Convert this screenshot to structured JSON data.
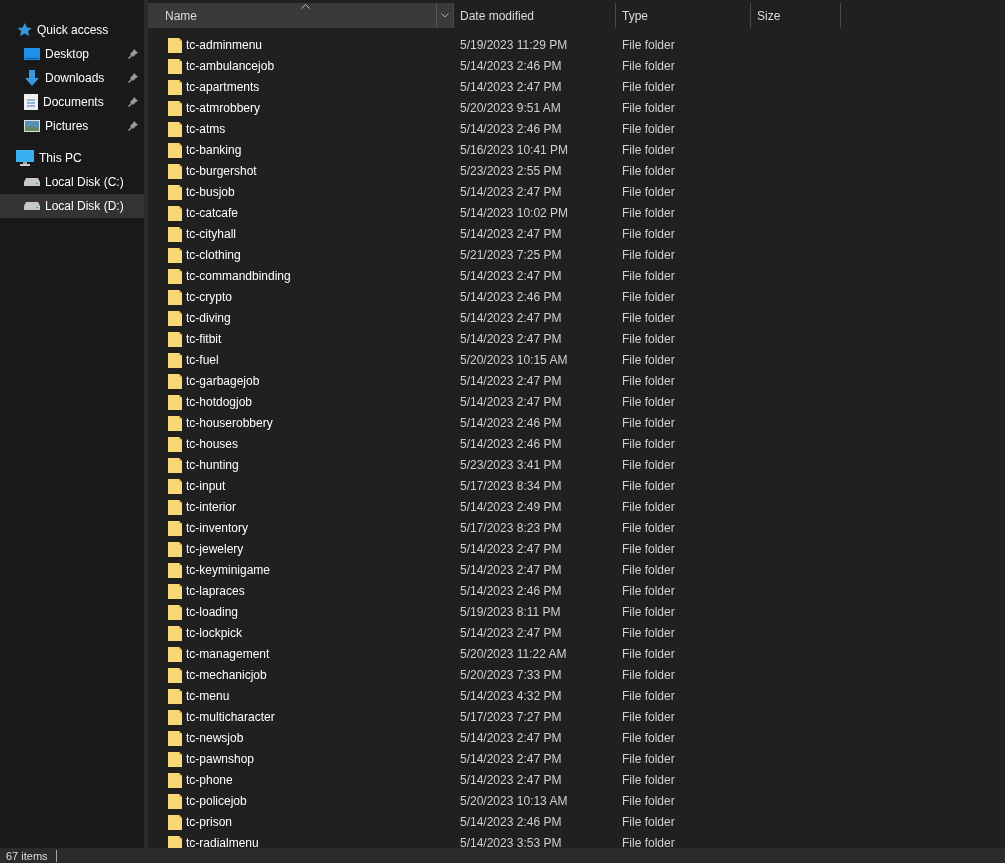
{
  "sidebar": {
    "groups": [
      {
        "label": "Quick access",
        "kind": "star",
        "selected": false,
        "children": [
          {
            "label": "Desktop",
            "kind": "desktop",
            "pinned": true,
            "selected": false
          },
          {
            "label": "Downloads",
            "kind": "download",
            "pinned": true,
            "selected": false
          },
          {
            "label": "Documents",
            "kind": "document",
            "pinned": true,
            "selected": false
          },
          {
            "label": "Pictures",
            "kind": "picture",
            "pinned": true,
            "selected": false
          }
        ]
      },
      {
        "label": "This PC",
        "kind": "pc",
        "selected": false,
        "children": [
          {
            "label": "Local Disk (C:)",
            "kind": "disk",
            "pinned": false,
            "selected": false
          },
          {
            "label": "Local Disk (D:)",
            "kind": "disk",
            "pinned": false,
            "selected": true
          }
        ]
      }
    ]
  },
  "table": {
    "columns": [
      {
        "label": "Name",
        "sorted": true,
        "hovered": true
      },
      {
        "label": "Date modified",
        "sorted": false,
        "hovered": false
      },
      {
        "label": "Type",
        "sorted": false,
        "hovered": false
      },
      {
        "label": "Size",
        "sorted": false,
        "hovered": false
      }
    ],
    "rows": [
      {
        "name": "tc-adminmenu",
        "date": "5/19/2023 11:29 PM",
        "type": "File folder"
      },
      {
        "name": "tc-ambulancejob",
        "date": "5/14/2023 2:46 PM",
        "type": "File folder"
      },
      {
        "name": "tc-apartments",
        "date": "5/14/2023 2:47 PM",
        "type": "File folder"
      },
      {
        "name": "tc-atmrobbery",
        "date": "5/20/2023 9:51 AM",
        "type": "File folder"
      },
      {
        "name": "tc-atms",
        "date": "5/14/2023 2:46 PM",
        "type": "File folder"
      },
      {
        "name": "tc-banking",
        "date": "5/16/2023 10:41 PM",
        "type": "File folder"
      },
      {
        "name": "tc-burgershot",
        "date": "5/23/2023 2:55 PM",
        "type": "File folder"
      },
      {
        "name": "tc-busjob",
        "date": "5/14/2023 2:47 PM",
        "type": "File folder"
      },
      {
        "name": "tc-catcafe",
        "date": "5/14/2023 10:02 PM",
        "type": "File folder"
      },
      {
        "name": "tc-cityhall",
        "date": "5/14/2023 2:47 PM",
        "type": "File folder"
      },
      {
        "name": "tc-clothing",
        "date": "5/21/2023 7:25 PM",
        "type": "File folder"
      },
      {
        "name": "tc-commandbinding",
        "date": "5/14/2023 2:47 PM",
        "type": "File folder"
      },
      {
        "name": "tc-crypto",
        "date": "5/14/2023 2:46 PM",
        "type": "File folder"
      },
      {
        "name": "tc-diving",
        "date": "5/14/2023 2:47 PM",
        "type": "File folder"
      },
      {
        "name": "tc-fitbit",
        "date": "5/14/2023 2:47 PM",
        "type": "File folder"
      },
      {
        "name": "tc-fuel",
        "date": "5/20/2023 10:15 AM",
        "type": "File folder"
      },
      {
        "name": "tc-garbagejob",
        "date": "5/14/2023 2:47 PM",
        "type": "File folder"
      },
      {
        "name": "tc-hotdogjob",
        "date": "5/14/2023 2:47 PM",
        "type": "File folder"
      },
      {
        "name": "tc-houserobbery",
        "date": "5/14/2023 2:46 PM",
        "type": "File folder"
      },
      {
        "name": "tc-houses",
        "date": "5/14/2023 2:46 PM",
        "type": "File folder"
      },
      {
        "name": "tc-hunting",
        "date": "5/23/2023 3:41 PM",
        "type": "File folder"
      },
      {
        "name": "tc-input",
        "date": "5/17/2023 8:34 PM",
        "type": "File folder"
      },
      {
        "name": "tc-interior",
        "date": "5/14/2023 2:49 PM",
        "type": "File folder"
      },
      {
        "name": "tc-inventory",
        "date": "5/17/2023 8:23 PM",
        "type": "File folder"
      },
      {
        "name": "tc-jewelery",
        "date": "5/14/2023 2:47 PM",
        "type": "File folder"
      },
      {
        "name": "tc-keyminigame",
        "date": "5/14/2023 2:47 PM",
        "type": "File folder"
      },
      {
        "name": "tc-lapraces",
        "date": "5/14/2023 2:46 PM",
        "type": "File folder"
      },
      {
        "name": "tc-loading",
        "date": "5/19/2023 8:11 PM",
        "type": "File folder"
      },
      {
        "name": "tc-lockpick",
        "date": "5/14/2023 2:47 PM",
        "type": "File folder"
      },
      {
        "name": "tc-management",
        "date": "5/20/2023 11:22 AM",
        "type": "File folder"
      },
      {
        "name": "tc-mechanicjob",
        "date": "5/20/2023 7:33 PM",
        "type": "File folder"
      },
      {
        "name": "tc-menu",
        "date": "5/14/2023 4:32 PM",
        "type": "File folder"
      },
      {
        "name": "tc-multicharacter",
        "date": "5/17/2023 7:27 PM",
        "type": "File folder"
      },
      {
        "name": "tc-newsjob",
        "date": "5/14/2023 2:47 PM",
        "type": "File folder"
      },
      {
        "name": "tc-pawnshop",
        "date": "5/14/2023 2:47 PM",
        "type": "File folder"
      },
      {
        "name": "tc-phone",
        "date": "5/14/2023 2:47 PM",
        "type": "File folder"
      },
      {
        "name": "tc-policejob",
        "date": "5/20/2023 10:13 AM",
        "type": "File folder"
      },
      {
        "name": "tc-prison",
        "date": "5/14/2023 2:46 PM",
        "type": "File folder"
      },
      {
        "name": "tc-radialmenu",
        "date": "5/14/2023 3:53 PM",
        "type": "File folder"
      }
    ]
  },
  "status_bar": {
    "item_count": "67 items"
  }
}
